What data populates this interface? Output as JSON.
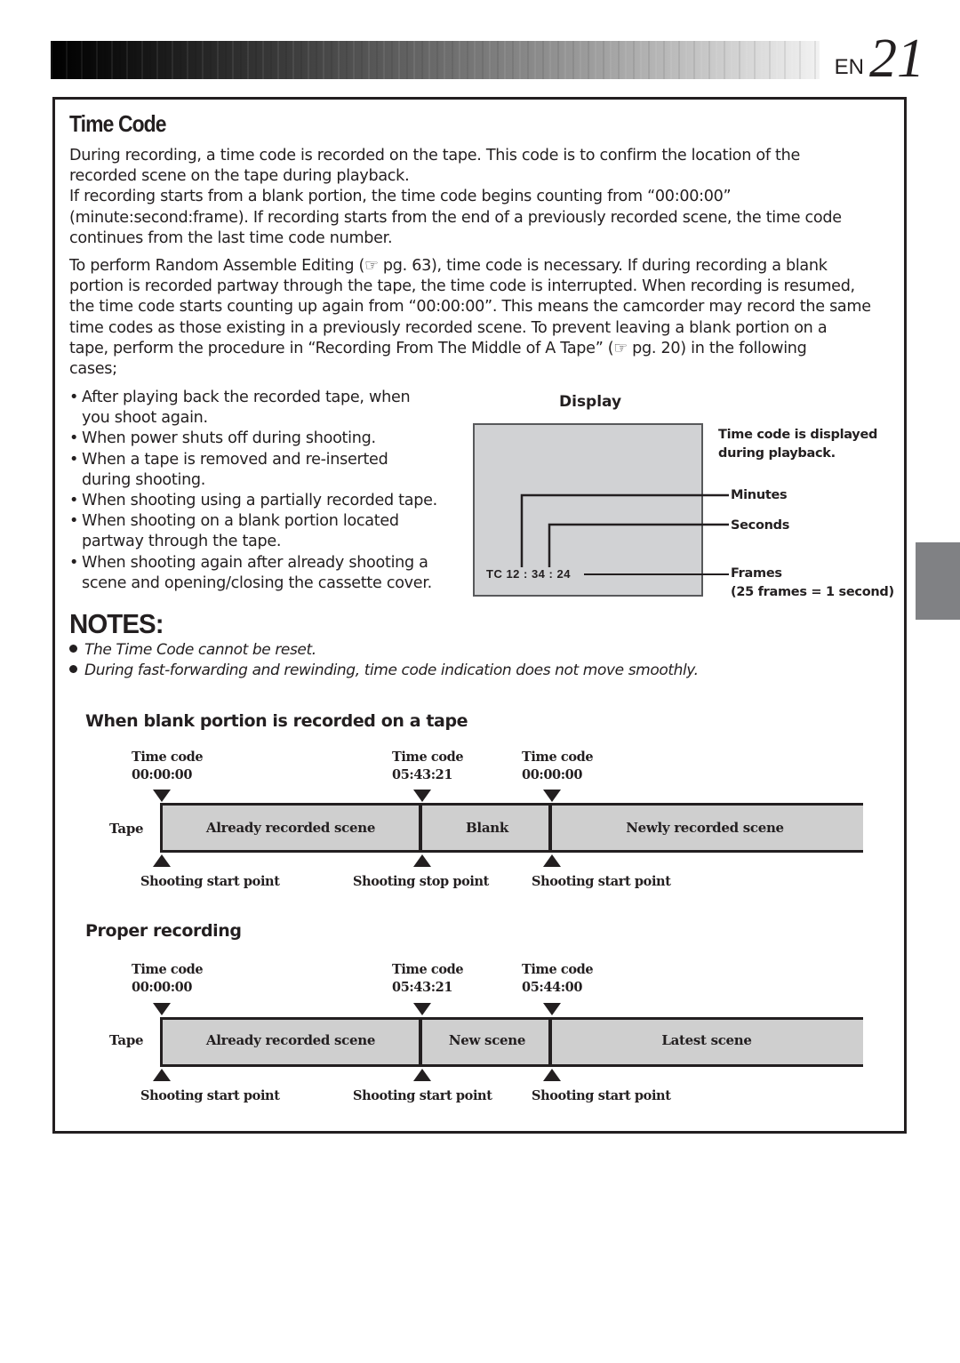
{
  "header": {
    "lang": "EN",
    "page_number": "21"
  },
  "section_title": "Time Code",
  "intro_paragraph": {
    "lines": [
      "During recording, a time code is recorded on the tape. This code is to confirm the location of the",
      "recorded scene on the tape during playback.",
      "If recording starts from a blank portion, the time code begins counting from “00:00:00”",
      "(minute:second:frame). If recording starts from the end of a previously recorded scene, the time code",
      "continues from the last time code number."
    ]
  },
  "editing_paragraph": {
    "lines": [
      "To perform Random Assemble Editing (☞ pg. 63), time code is necessary. If during recording a blank",
      "portion is recorded partway through the tape, the time code is interrupted. When recording is resumed,",
      "the time code starts counting up again from “00:00:00”. This means the camcorder may record the same",
      "time codes as those existing in a previously recorded scene. To prevent leaving a blank portion on a",
      "tape, perform the procedure in “Recording From The Middle of A Tape” (☞ pg. 20) in the following",
      "cases;"
    ]
  },
  "cases": [
    {
      "lines": [
        "After playing back the recorded tape, when",
        "you shoot again."
      ]
    },
    {
      "lines": [
        "When power shuts off during shooting."
      ]
    },
    {
      "lines": [
        "When a tape is removed and re-inserted",
        "during shooting."
      ]
    },
    {
      "lines": [
        "When shooting using a partially recorded tape."
      ]
    },
    {
      "lines": [
        "When shooting on a blank portion located",
        "partway through the tape."
      ]
    },
    {
      "lines": [
        "When shooting again after already shooting a",
        "scene and opening/closing the cassette cover."
      ]
    }
  ],
  "display_figure": {
    "title": "Display",
    "tc_readout": "TC  12 : 34 : 24",
    "caption_lines": [
      "Time code is displayed",
      "during playback."
    ],
    "labels": {
      "minutes": "Minutes",
      "seconds": "Seconds",
      "frames": "Frames",
      "frames_note": "(25 frames = 1 second)"
    },
    "screen_color": "#d1d2d4"
  },
  "notes": {
    "title": "NOTES:",
    "items": [
      "The Time Code cannot be reset.",
      "During fast-forwarding and rewinding, time code indication does not move smoothly."
    ]
  },
  "diagrams": [
    {
      "title": "When blank portion is recorded on a tape",
      "tape_label": "Tape",
      "markers": [
        {
          "tc_label": "Time code",
          "tc_value": "00:00:00",
          "point_label": "Shooting start point"
        },
        {
          "tc_label": "Time code",
          "tc_value": "05:43:21",
          "point_label": "Shooting stop point"
        },
        {
          "tc_label": "Time code",
          "tc_value": "00:00:00",
          "point_label": "Shooting start point"
        }
      ],
      "segments": [
        "Already recorded scene",
        "Blank",
        "Newly recorded scene"
      ]
    },
    {
      "title": "Proper recording",
      "tape_label": "Tape",
      "markers": [
        {
          "tc_label": "Time code",
          "tc_value": "00:00:00",
          "point_label": "Shooting start point"
        },
        {
          "tc_label": "Time code",
          "tc_value": "05:43:21",
          "point_label": "Shooting start point"
        },
        {
          "tc_label": "Time code",
          "tc_value": "05:44:00",
          "point_label": "Shooting start point"
        }
      ],
      "segments": [
        "Already recorded scene",
        "New scene",
        "Latest scene"
      ]
    }
  ],
  "colors": {
    "text": "#231f20",
    "tape_fill": "#cfcfcf",
    "side_tab": "#808184"
  }
}
